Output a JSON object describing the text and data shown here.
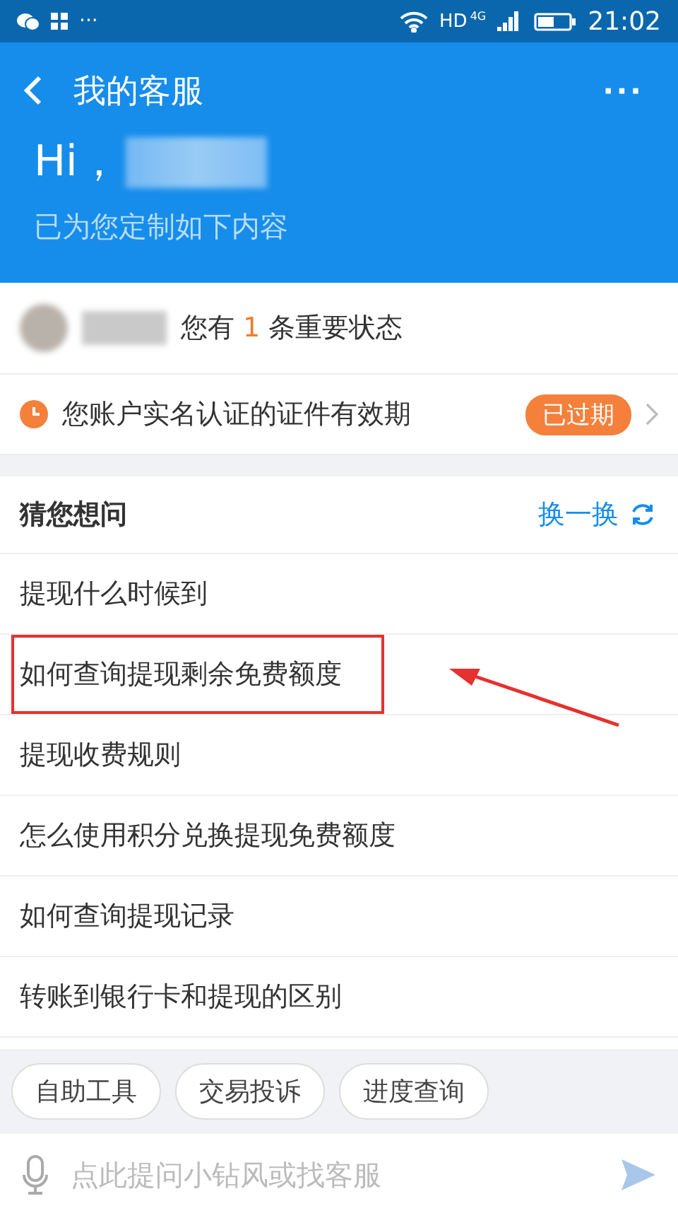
{
  "status_bar": {
    "more": "···",
    "network": "HD",
    "generation": "4G",
    "time": "21:02"
  },
  "header": {
    "title": "我的客服",
    "more": "···",
    "greeting": "Hi，",
    "subtitle": "已为您定制如下内容"
  },
  "status_summary": {
    "prefix": "您有",
    "count": "1",
    "suffix": "条重要状态"
  },
  "notice": {
    "text": "您账户实名认证的证件有效期",
    "badge": "已过期"
  },
  "suggestions": {
    "title": "猜您想问",
    "refresh": "换一换",
    "questions": [
      {
        "text": "提现什么时候到",
        "highlighted": false
      },
      {
        "text": "如何查询提现剩余免费额度",
        "highlighted": true
      },
      {
        "text": "提现收费规则",
        "highlighted": false
      },
      {
        "text": "怎么使用积分兑换提现免费额度",
        "highlighted": false
      },
      {
        "text": "如何查询提现记录",
        "highlighted": false
      },
      {
        "text": "转账到银行卡和提现的区别",
        "highlighted": false
      }
    ]
  },
  "quick_chips": [
    "自助工具",
    "交易投诉",
    "进度查询"
  ],
  "input_bar": {
    "placeholder": "点此提问小钻风或找客服"
  }
}
